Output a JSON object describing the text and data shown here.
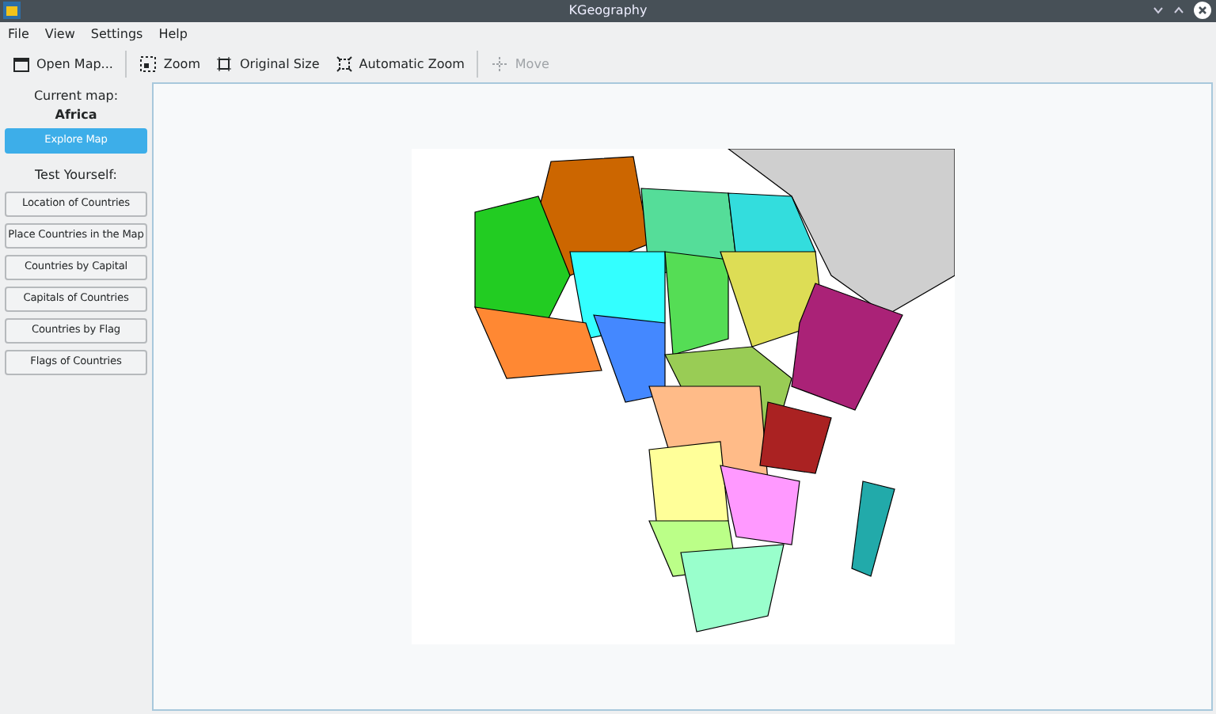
{
  "window": {
    "title": "KGeography"
  },
  "menu": [
    "File",
    "View",
    "Settings",
    "Help"
  ],
  "toolbar": [
    {
      "kind": "open",
      "label": "Open Map...",
      "disabled": false
    },
    {
      "kind": "zoom",
      "label": "Zoom",
      "disabled": false
    },
    {
      "kind": "original",
      "label": "Original Size",
      "disabled": false
    },
    {
      "kind": "auto",
      "label": "Automatic Zoom",
      "disabled": false
    },
    {
      "kind": "move",
      "label": "Move",
      "disabled": true
    }
  ],
  "sidebar": {
    "current_label": "Current map:",
    "current_map": "Africa",
    "explore": {
      "label": "Explore Map",
      "selected": true
    },
    "test_label": "Test Yourself:",
    "tests": [
      {
        "label": "Location of Countries",
        "selected": false
      },
      {
        "label": "Place Countries in the Map",
        "selected": false
      },
      {
        "label": "Countries by Capital",
        "selected": false
      },
      {
        "label": "Capitals of Countries",
        "selected": false
      },
      {
        "label": "Countries by Flag",
        "selected": false
      },
      {
        "label": "Flags of Countries",
        "selected": false
      }
    ]
  }
}
